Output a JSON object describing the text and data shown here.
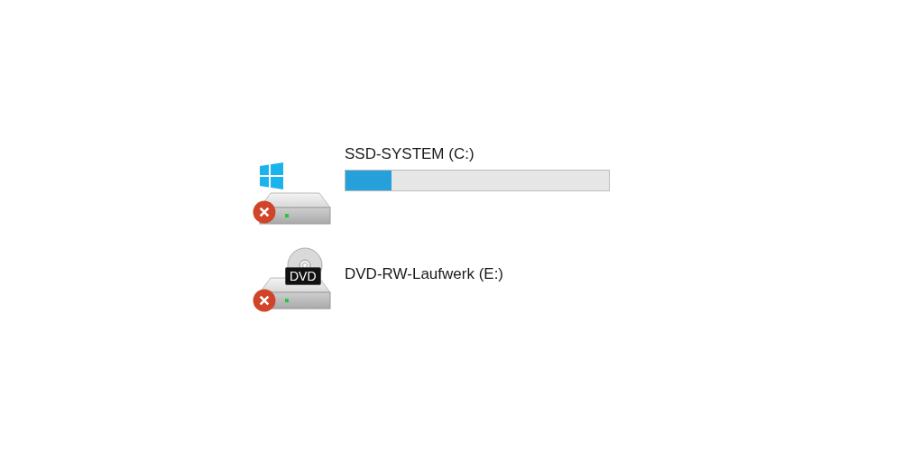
{
  "drives": [
    {
      "kind": "system",
      "name": "SSD-SYSTEM (C:)",
      "error": true,
      "level": 0.175
    },
    {
      "kind": "dvd",
      "name": "DVD-RW-Laufwerk (E:)",
      "error": true,
      "badge": "DVD"
    }
  ]
}
